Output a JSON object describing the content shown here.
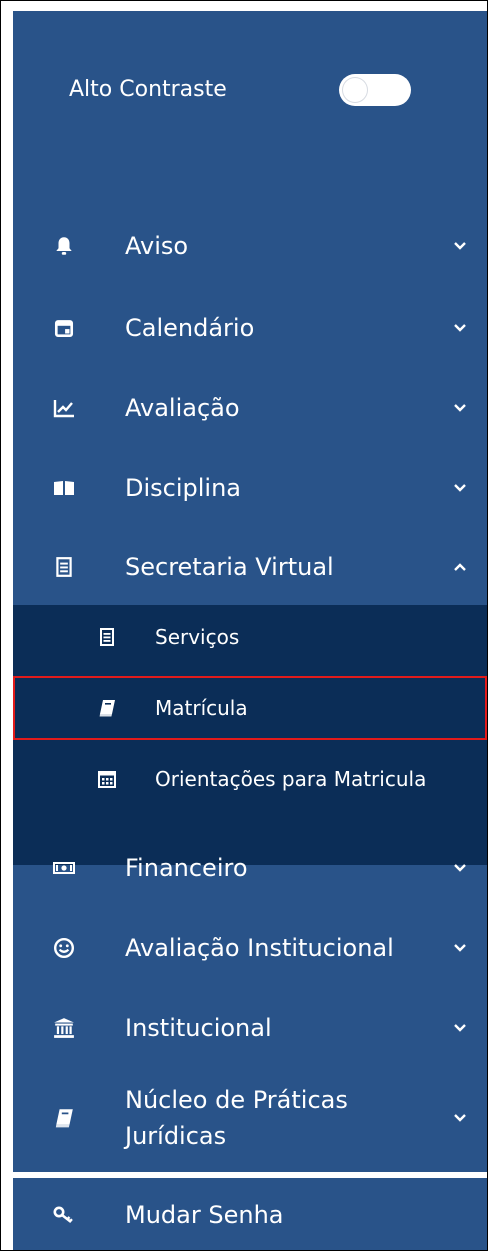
{
  "contrast": {
    "label": "Alto Contraste",
    "enabled": false
  },
  "menu": [
    {
      "id": "aviso",
      "label": "Aviso",
      "icon": "bell-icon",
      "expanded": false
    },
    {
      "id": "calendario",
      "label": "Calendário",
      "icon": "calendar-icon",
      "expanded": false
    },
    {
      "id": "avaliacao",
      "label": "Avaliação",
      "icon": "line-chart-icon",
      "expanded": false
    },
    {
      "id": "disciplina",
      "label": "Disciplina",
      "icon": "open-book-icon",
      "expanded": false
    },
    {
      "id": "secretaria",
      "label": "Secretaria Virtual",
      "icon": "document-list-icon",
      "expanded": true,
      "children": [
        {
          "id": "servicos",
          "label": "Serviços",
          "icon": "document-list-icon",
          "selected": false
        },
        {
          "id": "matricula",
          "label": "Matrícula",
          "icon": "book-icon",
          "selected": true
        },
        {
          "id": "orientacoes",
          "label": "Orientações para Matricula",
          "icon": "calendar-grid-icon",
          "selected": false
        }
      ]
    },
    {
      "id": "financeiro",
      "label": "Financeiro",
      "icon": "money-icon",
      "expanded": false
    },
    {
      "id": "avaliacao-institucional",
      "label": "Avaliação Institucional",
      "icon": "smile-icon",
      "expanded": false
    },
    {
      "id": "institucional",
      "label": "Institucional",
      "icon": "institution-icon",
      "expanded": false
    },
    {
      "id": "npj",
      "label": "Núcleo de Práticas Jurídicas",
      "icon": "book-icon",
      "expanded": false
    }
  ],
  "footer": {
    "label": "Mudar Senha",
    "icon": "key-icon"
  },
  "colors": {
    "sidebar": "#295389",
    "submenu": "#0b2d57",
    "text": "#ffffff",
    "highlight": "#e21b1b"
  }
}
